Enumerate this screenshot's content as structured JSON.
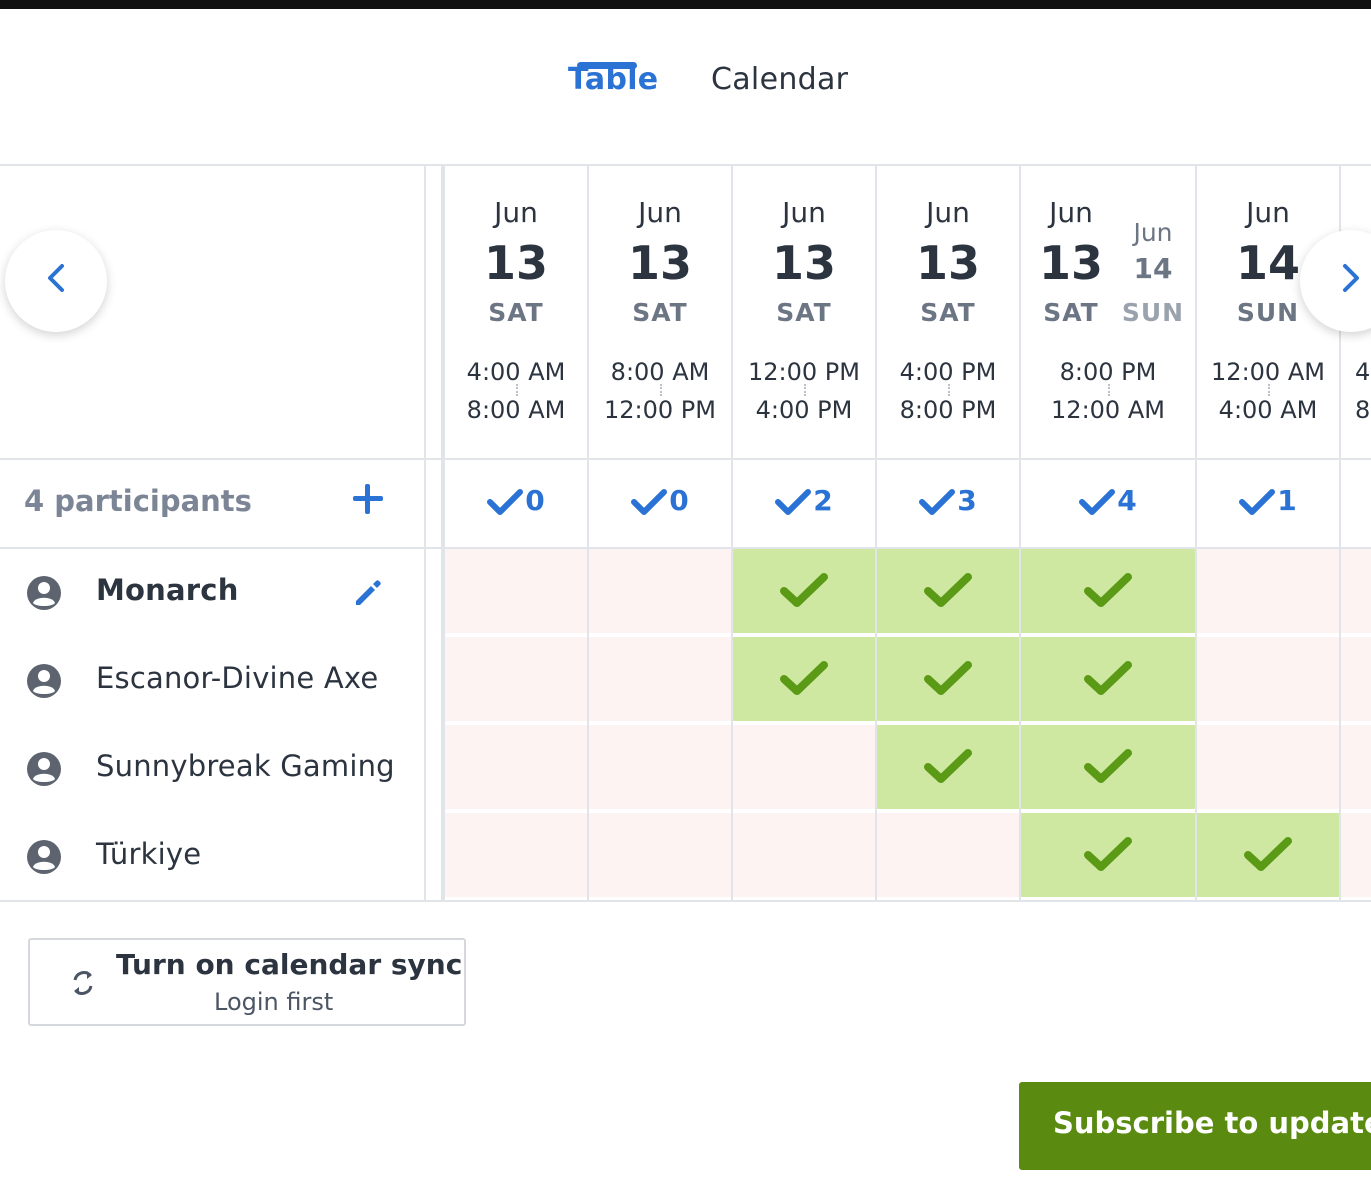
{
  "tabs": [
    {
      "label": "Table",
      "active": true
    },
    {
      "label": "Calendar",
      "active": false
    }
  ],
  "participants_label": "4 participants",
  "participants": [
    {
      "name": "Monarch",
      "bold": true
    },
    {
      "name": "Escanor-Divine Axe",
      "bold": false
    },
    {
      "name": "Sunnybreak Gaming",
      "bold": false
    },
    {
      "name": "Türkiye",
      "bold": false
    }
  ],
  "columns": [
    {
      "month": "Jun",
      "day": "13",
      "dow": "SAT",
      "start": "4:00 AM",
      "end": "8:00 AM",
      "count": "0",
      "votes": [
        false,
        false,
        false,
        false
      ]
    },
    {
      "month": "Jun",
      "day": "13",
      "dow": "SAT",
      "start": "8:00 AM",
      "end": "12:00 PM",
      "count": "0",
      "votes": [
        false,
        false,
        false,
        false
      ]
    },
    {
      "month": "Jun",
      "day": "13",
      "dow": "SAT",
      "start": "12:00 PM",
      "end": "4:00 PM",
      "count": "2",
      "votes": [
        true,
        true,
        false,
        false
      ]
    },
    {
      "month": "Jun",
      "day": "13",
      "dow": "SAT",
      "start": "4:00 PM",
      "end": "8:00 PM",
      "count": "3",
      "votes": [
        true,
        true,
        true,
        false
      ]
    },
    {
      "month": "Jun",
      "day": "13",
      "dow": "SAT",
      "month2": "Jun",
      "day2": "14",
      "dow2": "SUN",
      "start": "8:00 PM",
      "end": "12:00 AM",
      "count": "4",
      "votes": [
        true,
        true,
        true,
        true
      ]
    },
    {
      "month": "Jun",
      "day": "14",
      "dow": "SUN",
      "start": "12:00 AM",
      "end": "4:00 AM",
      "count": "1",
      "votes": [
        false,
        false,
        false,
        true
      ]
    },
    {
      "month": "",
      "day": "",
      "dow": "",
      "start": "4",
      "end": "8",
      "count": "",
      "votes": [
        false,
        false,
        false,
        false
      ]
    }
  ],
  "calendar_sync": {
    "title": "Turn on calendar sync",
    "subtitle": "Login first"
  },
  "subscribe_label": "Subscribe to updates",
  "colors": {
    "accent": "#2a72d4",
    "yes": "#cfe8a1",
    "no": "#fdf3f3",
    "check": "#5a9a16",
    "subscribe": "#5a8a10"
  },
  "icons": [
    "chevron-left-icon",
    "chevron-right-icon",
    "plus-icon",
    "pencil-icon",
    "user-circle-icon",
    "check-icon",
    "sync-icon"
  ]
}
